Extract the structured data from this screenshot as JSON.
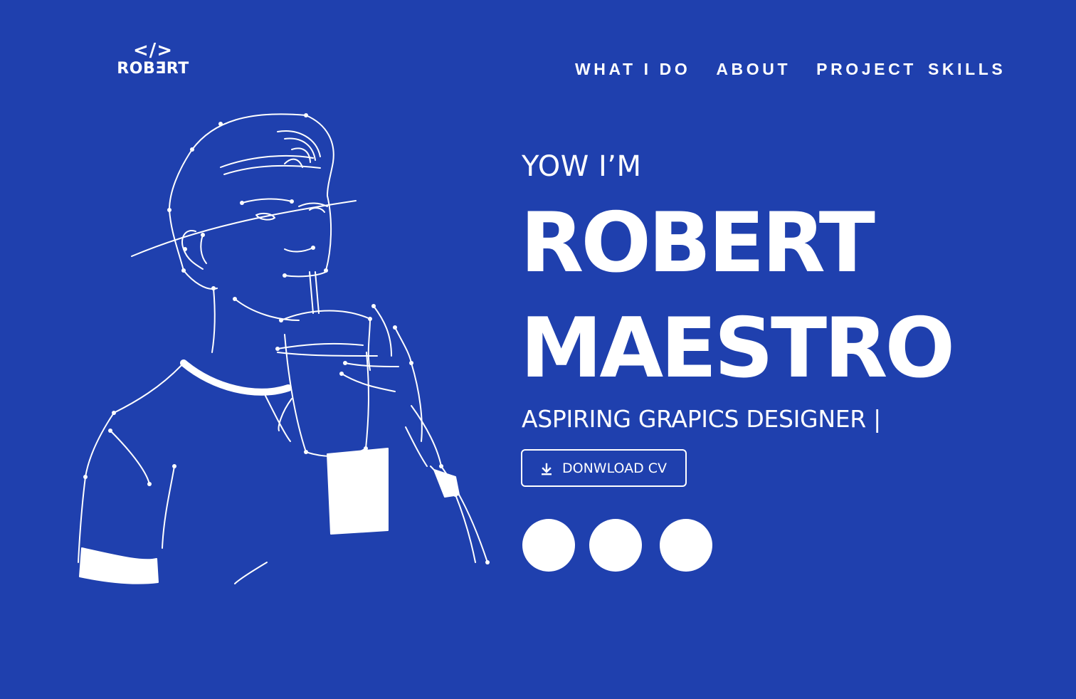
{
  "colors": {
    "background": "#1f40ae",
    "foreground": "#ffffff"
  },
  "logo": {
    "mark": "</>",
    "text": "ROBƎRT"
  },
  "nav": {
    "items": [
      {
        "label": "WHAT I DO"
      },
      {
        "label": "ABOUT"
      },
      {
        "label": "PROJECT"
      },
      {
        "label": "SKILLS"
      }
    ]
  },
  "hero": {
    "greeting": "YOW  I’M",
    "name_line1": "ROBERT",
    "name_line2": "MAESTRO",
    "role": "ASPIRING GRAPICS DESIGNER |",
    "cv_button_label": "DONWLOAD CV",
    "cv_button_icon": "download-icon",
    "socials": [
      {
        "icon": "social-icon"
      },
      {
        "icon": "social-icon"
      },
      {
        "icon": "social-icon"
      }
    ]
  },
  "illustration": {
    "icon": "line-drawing-portrait"
  }
}
